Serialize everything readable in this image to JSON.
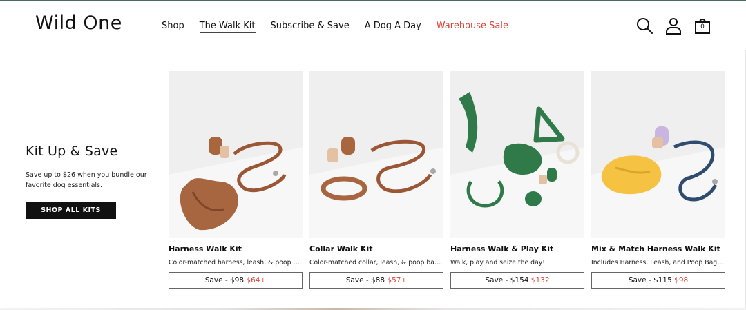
{
  "brand": {
    "logo": "Wild One"
  },
  "nav": {
    "items": [
      {
        "label": "Shop"
      },
      {
        "label": "The Walk Kit"
      },
      {
        "label": "Subscribe & Save"
      },
      {
        "label": "A Dog A Day"
      },
      {
        "label": "Warehouse Sale"
      }
    ]
  },
  "header_icons": {
    "cart_count": "0",
    "icons": [
      "search-icon",
      "account-icon",
      "cart-icon"
    ]
  },
  "colors": {
    "sale": "#d9463b",
    "accent_rule": "#4b6a5e"
  },
  "promo": {
    "title": "Kit Up & Save",
    "text": "Save up to $26 when you bundle our favorite dog essentials.",
    "button": "SHOP ALL KITS"
  },
  "products": [
    {
      "title": "Harness Walk Kit",
      "desc": "Color-matched harness, leash, & poop bag carrier",
      "save_label": "Save -",
      "old_price": "$98",
      "new_price": "$64+"
    },
    {
      "title": "Collar Walk Kit",
      "desc": "Color-matched collar, leash, & poop bag carrier",
      "save_label": "Save -",
      "old_price": "$88",
      "new_price": "$57+"
    },
    {
      "title": "Harness Walk & Play Kit",
      "desc": "Walk, play and seize the day!",
      "save_label": "Save -",
      "old_price": "$154",
      "new_price": "$132"
    },
    {
      "title": "Mix & Match Harness Walk Kit",
      "desc": "Includes Harness, Leash, and Poop Bag Carrier",
      "save_label": "Save -",
      "old_price": "$115",
      "new_price": "$98"
    }
  ]
}
